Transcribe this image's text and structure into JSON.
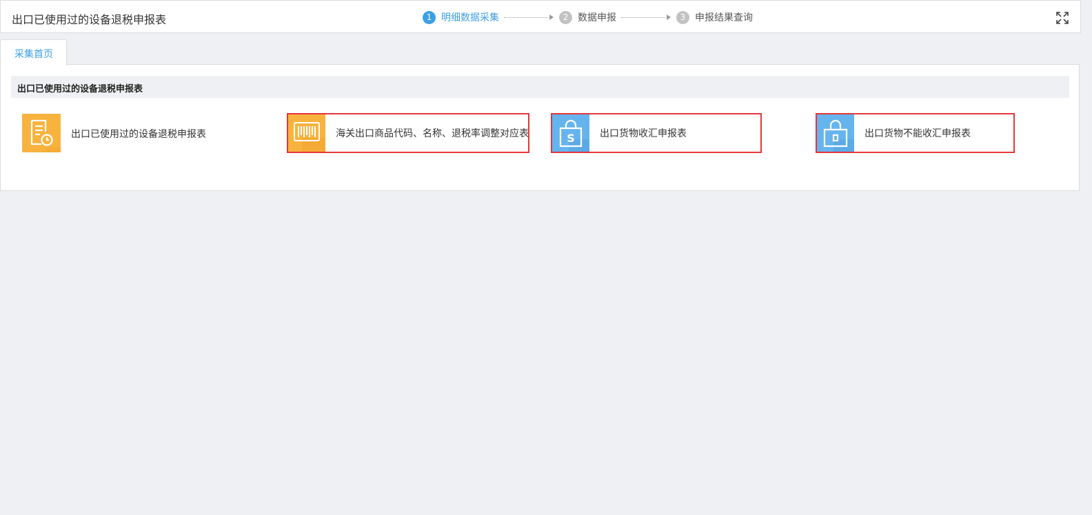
{
  "header": {
    "title": "出口已使用过的设备退税申报表",
    "steps": [
      {
        "num": "1",
        "label": "明细数据采集",
        "active": true
      },
      {
        "num": "2",
        "label": "数据申报",
        "active": false
      },
      {
        "num": "3",
        "label": "申报结果查询",
        "active": false
      }
    ],
    "expand_icon": "fullscreen-icon"
  },
  "tabs": [
    {
      "label": "采集首页",
      "active": true
    }
  ],
  "section": {
    "title": "出口已使用过的设备退税申报表"
  },
  "cards": [
    {
      "label": "出口已使用过的设备退税申报表",
      "icon": "document-clock-icon",
      "color": "#f8b33e",
      "highlighted": false
    },
    {
      "label": "海关出口商品代码、名称、退税率调整对应表",
      "icon": "barcode-icon",
      "color": "#f8b33e",
      "highlighted": true
    },
    {
      "label": "出口货物收汇申报表",
      "icon": "shopping-bag-dollar-icon",
      "color": "#66b4ee",
      "highlighted": true
    },
    {
      "label": "出口货物不能收汇申报表",
      "icon": "shopping-bag-lock-icon",
      "color": "#66b4ee",
      "highlighted": true
    }
  ],
  "colors": {
    "accent": "#3d9fe6",
    "highlight_border": "#e6343b",
    "orange_tile": "#f8b33e",
    "blue_tile": "#66b4ee"
  }
}
